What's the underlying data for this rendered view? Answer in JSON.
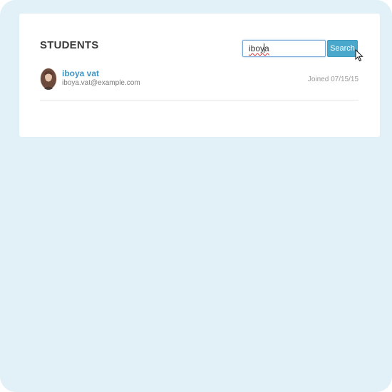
{
  "page": {
    "title": "STUDENTS"
  },
  "search": {
    "value": "iboya",
    "button_label": "Search"
  },
  "students": [
    {
      "name": "iboya vat",
      "email": "iboya.vat@example.com",
      "joined": "Joined 07/15/15"
    }
  ],
  "colors": {
    "background": "#e2f0f7",
    "card": "#ffffff",
    "accent": "#4aa8cc",
    "link": "#3a96c6"
  },
  "icons": {
    "cursor": "mouse-pointer-icon",
    "avatar": "student-photo"
  }
}
